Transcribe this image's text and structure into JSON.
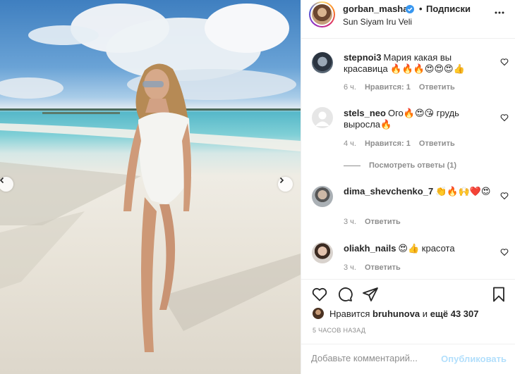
{
  "post": {
    "username": "gorban_masha",
    "follow_dot": "•",
    "follow_label": "Подписки",
    "location": "Sun Siyam Iru Veli"
  },
  "comments": [
    {
      "user": "stepnoi3",
      "text": "Мария какая вы красавица 🔥🔥🔥😍😍😍👍",
      "time": "6 ч.",
      "likes": "Нравится: 1",
      "reply": "Ответить"
    },
    {
      "user": "stels_neo",
      "text": "Ого🔥😍😘 грудь выросла🔥",
      "time": "4 ч.",
      "likes": "Нравится: 1",
      "reply": "Ответить"
    },
    {
      "user": "dima_shevchenko_7",
      "text": "👏🔥🙌❤️😍",
      "time": "3 ч.",
      "reply": "Ответить"
    },
    {
      "user": "oliakh_nails",
      "text": "😍👍 красота",
      "time": "3 ч.",
      "reply": "Ответить"
    }
  ],
  "view_replies": "Посмотреть ответы (1)",
  "likes": {
    "prefix": "Нравится",
    "user": "bruhunova",
    "middle": "и",
    "others": "ещё 43 307"
  },
  "timestamp": "5 ЧАСОВ НАЗАД",
  "comment_input": {
    "placeholder": "Добавьте комментарий...",
    "value": ""
  },
  "publish_label": "Опубликовать",
  "icons": {
    "verified": "verified-badge-icon",
    "more": "more-options-icon",
    "like": "heart-icon",
    "comment": "comment-icon",
    "share": "paper-plane-icon",
    "save": "bookmark-icon",
    "prev": "chevron-left-icon",
    "next": "chevron-right-icon"
  },
  "colors": {
    "verified": "#3897f0",
    "publish": "#b2dffc",
    "meta": "#8e8e8e"
  }
}
